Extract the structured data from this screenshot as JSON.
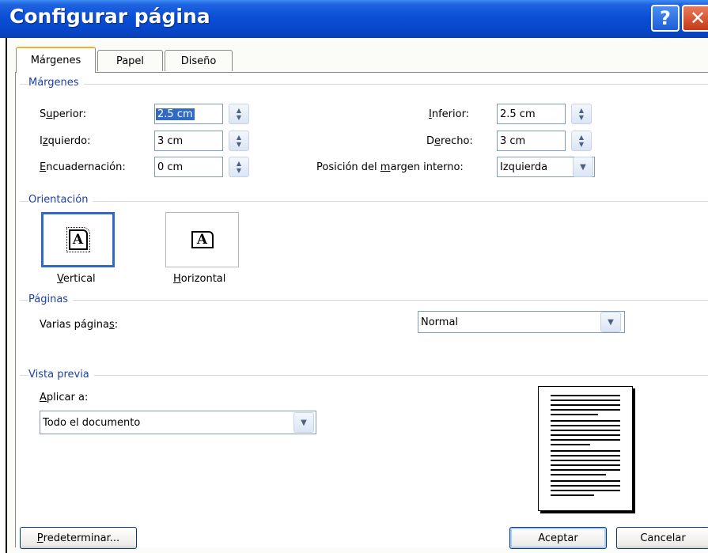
{
  "window": {
    "title": "Configurar página",
    "help_glyph": "?",
    "close_glyph": "✕"
  },
  "tabs": [
    {
      "label": "Márgenes",
      "active": true
    },
    {
      "label": "Papel",
      "active": false
    },
    {
      "label": "Diseño",
      "active": false
    }
  ],
  "margins": {
    "group_title": "Márgenes",
    "top": {
      "label_pre": "S",
      "label_ul": "u",
      "label_post": "perior:",
      "value": "2.5 cm"
    },
    "left": {
      "label_pre": "I",
      "label_ul": "z",
      "label_post": "quierdo:",
      "value": "3 cm"
    },
    "gutter": {
      "label_pre": "",
      "label_ul": "E",
      "label_post": "ncuadernación:",
      "value": "0 cm"
    },
    "bottom": {
      "label_pre": "",
      "label_ul": "I",
      "label_post": "nferior:",
      "value": "2.5 cm"
    },
    "right": {
      "label_pre": "D",
      "label_ul": "e",
      "label_post": "recho:",
      "value": "3 cm"
    },
    "gutter_pos": {
      "label_pre": "Posición del ",
      "label_ul": "m",
      "label_post": "argen interno:",
      "value": "Izquierda"
    }
  },
  "orientation": {
    "group_title": "Orientación",
    "glyph": "A",
    "vertical": {
      "label_ul": "V",
      "label_post": "ertical",
      "selected": true
    },
    "horizontal": {
      "label_ul": "H",
      "label_post": "orizontal",
      "selected": false
    }
  },
  "pages": {
    "group_title": "Páginas",
    "multiple_pre": "Varias página",
    "multiple_ul": "s",
    "multiple_post": ":",
    "value": "Normal"
  },
  "preview": {
    "group_title": "Vista previa",
    "apply_ul": "A",
    "apply_post": "plicar a:",
    "apply_value": "Todo el documento"
  },
  "buttons": {
    "default_ul": "P",
    "default_post": "redeterminar...",
    "ok": "Aceptar",
    "cancel": "Cancelar"
  },
  "colors": {
    "title_bar": "#0a4fd6",
    "group_title": "#1c3fa8",
    "selection": "#316ac5",
    "close_button": "#c63a15"
  },
  "icons": {
    "spin": "spin-arrows-icon",
    "dropdown": "chevron-down-icon",
    "help": "help-icon",
    "close": "close-icon",
    "page": "page-icon"
  }
}
